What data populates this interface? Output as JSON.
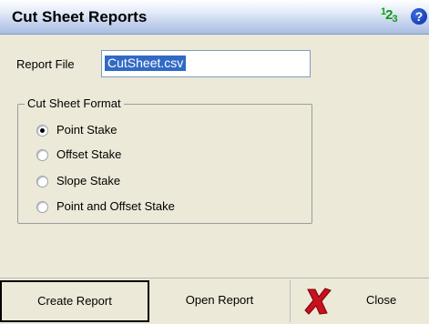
{
  "window": {
    "title": "Cut Sheet Reports",
    "numeric_icon": {
      "a": "1",
      "b": "2",
      "c": "3"
    },
    "help_icon": "?"
  },
  "report_file": {
    "label": "Report File",
    "value": "CutSheet.csv"
  },
  "format_group": {
    "label": "Cut Sheet Format",
    "options": [
      {
        "label": "Point Stake",
        "checked": true
      },
      {
        "label": "Offset Stake",
        "checked": false
      },
      {
        "label": "Slope Stake",
        "checked": false
      },
      {
        "label": "Point and Offset Stake",
        "checked": false
      }
    ]
  },
  "footer": {
    "create_label": "Create Report",
    "open_label": "Open Report",
    "close_label": "Close"
  },
  "colors": {
    "accent": "#316ac5",
    "close_x": "#c8101e"
  }
}
